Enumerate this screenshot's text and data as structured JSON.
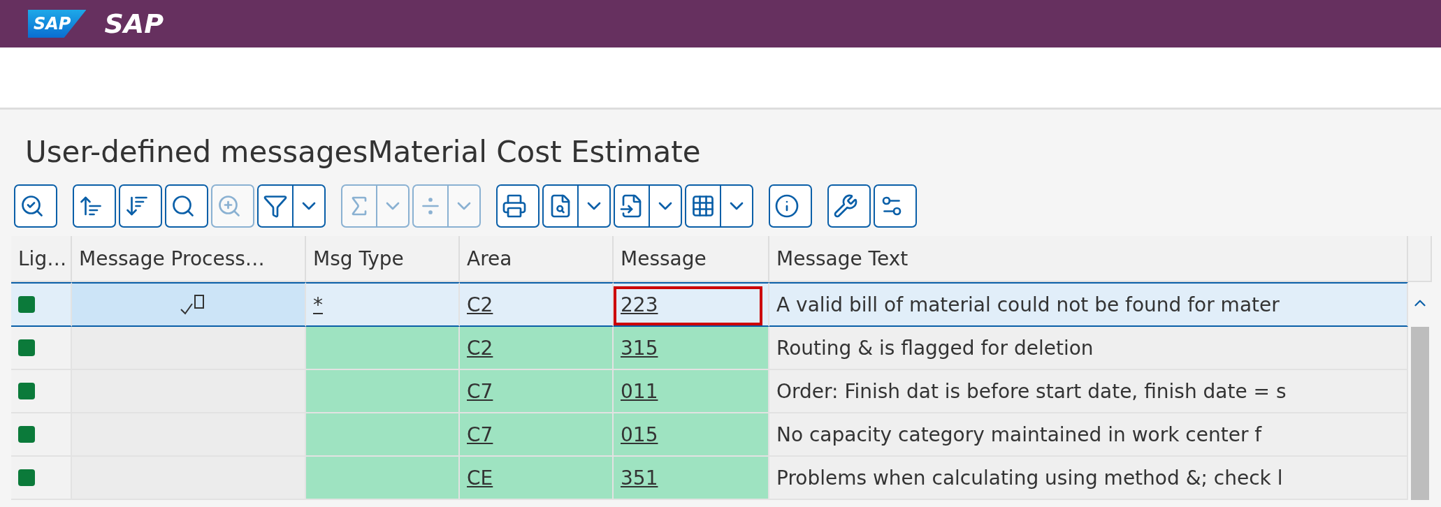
{
  "shell": {
    "logo": "SAP",
    "title": "SAP"
  },
  "title": "User-defined messagesMaterial Cost Estimate",
  "toolbar": [
    [
      {
        "kind": "button",
        "disabled": false
      }
    ],
    [
      {
        "kind": "button",
        "disabled": false
      },
      {
        "kind": "button",
        "disabled": false
      },
      {
        "kind": "button",
        "disabled": false
      },
      {
        "kind": "button",
        "disabled": true
      },
      {
        "kind": "split",
        "disabled": false
      }
    ],
    [
      {
        "kind": "split",
        "disabled": true
      },
      {
        "kind": "split",
        "disabled": true
      }
    ],
    [
      {
        "kind": "button",
        "disabled": false
      },
      {
        "kind": "split",
        "disabled": false
      },
      {
        "kind": "split",
        "disabled": false
      },
      {
        "kind": "split",
        "disabled": false
      }
    ],
    [
      {
        "kind": "button",
        "disabled": false
      }
    ],
    [
      {
        "kind": "button",
        "disabled": false
      },
      {
        "kind": "button",
        "disabled": false
      }
    ]
  ],
  "table": {
    "columns": [
      "Lig…",
      "Message Process…",
      "Msg Type",
      "Area",
      "Message",
      "Message Text"
    ],
    "rows": [
      {
        "selected": true,
        "color": "#0b7a3a",
        "processing_checked": true,
        "msg_type": "*",
        "area": "C2",
        "message": "223",
        "highlighted": true,
        "text": "A valid bill of material could not be found for mater"
      },
      {
        "selected": false,
        "color": "#0b7a3a",
        "processing_checked": false,
        "msg_type": "",
        "area": "C2",
        "message": "315",
        "highlighted": false,
        "text": "Routing & is flagged for deletion"
      },
      {
        "selected": false,
        "color": "#0b7a3a",
        "processing_checked": false,
        "msg_type": "",
        "area": "C7",
        "message": "011",
        "highlighted": false,
        "text": "Order: Finish dat is before start date, finish date = s"
      },
      {
        "selected": false,
        "color": "#0b7a3a",
        "processing_checked": false,
        "msg_type": "",
        "area": "C7",
        "message": "015",
        "highlighted": false,
        "text": "No capacity category maintained in work center f"
      },
      {
        "selected": false,
        "color": "#0b7a3a",
        "processing_checked": false,
        "msg_type": "",
        "area": "CE",
        "message": "351",
        "highlighted": false,
        "text": "Problems when calculating using method &; check l"
      }
    ]
  }
}
